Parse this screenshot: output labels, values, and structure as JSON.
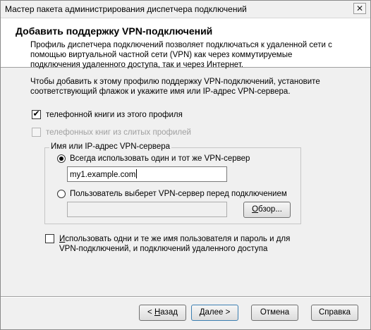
{
  "window": {
    "title": "Мастер пакета администрирования диспетчера подключений",
    "close_glyph": "✕"
  },
  "header": {
    "title": "Добавить поддержку VPN-подключений",
    "description": "Профиль диспетчера подключений позволяет подключаться к удаленной сети с помощью виртуальной частной сети (VPN) как через коммутируемые подключения удаленного доступа, так и через Интернет."
  },
  "instructions": "Чтобы добавить к этому профилю поддержку VPN-подключений, установите соответствующий флажок и укажите имя или IP-адрес VPN-сервера.",
  "options": {
    "phonebook_this_profile": {
      "label": "телефонной книги из этого профиля",
      "checked": true,
      "mark": "✔"
    },
    "phonebook_merged": {
      "label": "телефонных книг из слитых профилей",
      "checked": false
    }
  },
  "server_group": {
    "title": "Имя или IP-адрес VPN-сервера",
    "always_same": {
      "label": "Всегда использовать один и тот же VPN-сервер",
      "selected": true
    },
    "server_value": "my1.example.com",
    "user_choice": {
      "label": "Пользователь выберет VPN-сервер перед подключением",
      "selected": false
    },
    "user_choice_value": "",
    "browse": {
      "prefix": "",
      "accel": "О",
      "rest": "бзор..."
    }
  },
  "same_credentials": {
    "label_accel": "И",
    "label_rest": "спользовать одни и те же имя пользователя и пароль и для VPN-подключений, и подключений удаленного доступа",
    "checked": false
  },
  "buttons": {
    "back": {
      "prefix": "< ",
      "accel": "Н",
      "rest": "азад"
    },
    "next": {
      "prefix": "",
      "accel": "Д",
      "rest": "алее >"
    },
    "cancel": "Отмена",
    "help": "Справка"
  }
}
